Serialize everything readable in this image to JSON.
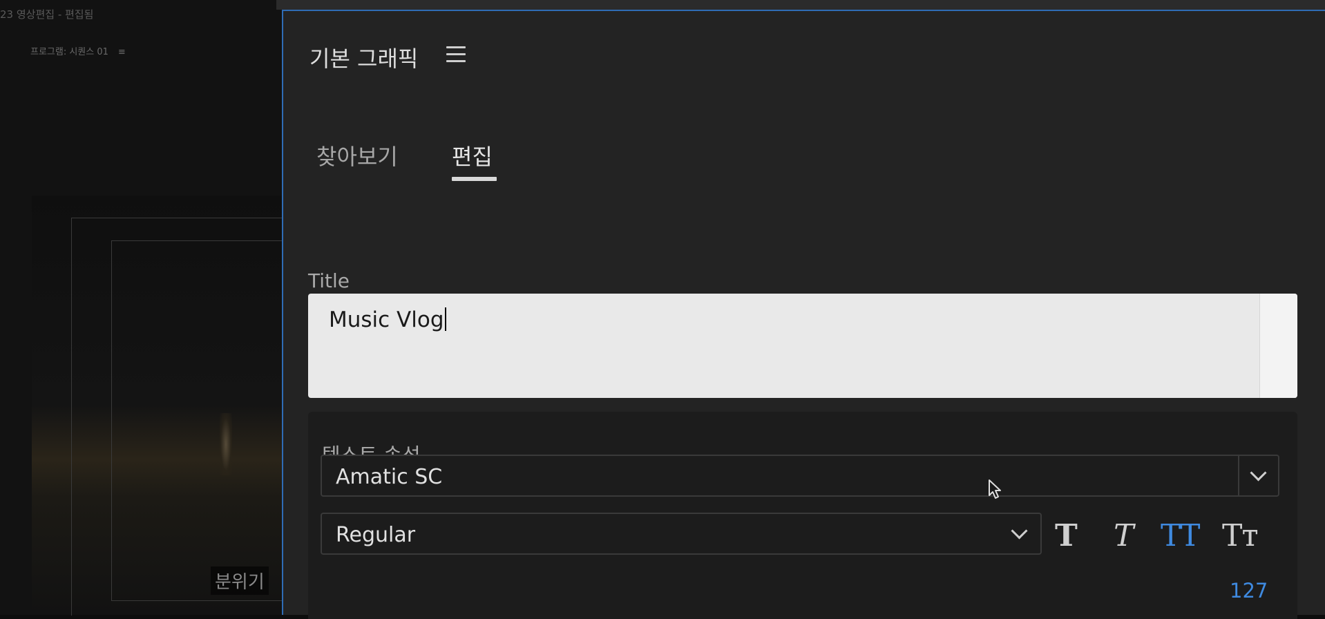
{
  "background": {
    "window_title": "23 영상편집 - 편집됨",
    "monitor_label": "프로그램: 시퀀스 01",
    "monitor_menu_icon": "≡",
    "caption": "분위기"
  },
  "panel": {
    "title": "기본 그래픽",
    "menu_icon": "hamburger-menu-icon",
    "tabs": [
      {
        "label": "찾아보기",
        "active": false
      },
      {
        "label": "편집",
        "active": true
      }
    ],
    "layer_name_label": "Title",
    "layer_text_value": "Music Vlog",
    "text_properties": {
      "heading": "텍스트 속성",
      "font_family": "Amatic SC",
      "font_style": "Regular",
      "style_buttons": [
        {
          "name": "faux-bold",
          "glyph": "T",
          "active": false
        },
        {
          "name": "faux-italic",
          "glyph": "T",
          "active": false
        },
        {
          "name": "all-caps",
          "glyph": "TT",
          "active": true
        },
        {
          "name": "small-caps",
          "glyph": "Tт",
          "active": false
        }
      ],
      "font_size": "127"
    }
  },
  "colors": {
    "panel_border": "#2f6cb5",
    "accent_blue": "#3f8ae0",
    "panel_bg": "#232323"
  }
}
